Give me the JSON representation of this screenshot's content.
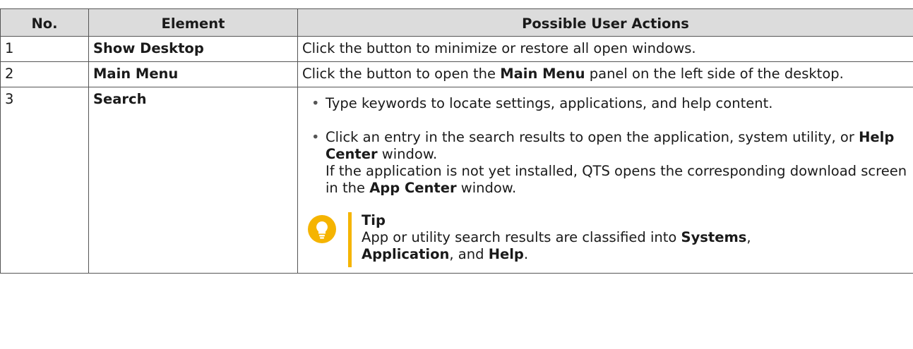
{
  "table": {
    "headers": {
      "no": "No.",
      "element": "Element",
      "actions": "Possible User Actions"
    },
    "rows": [
      {
        "no": "1",
        "element": "Show Desktop",
        "action": "Click the button to minimize or restore all open windows."
      },
      {
        "no": "2",
        "element": "Main Menu",
        "action_pre": "Click the button to open the ",
        "action_bold": "Main Menu",
        "action_post": " panel on the left side of the desktop."
      },
      {
        "no": "3",
        "element": "Search",
        "bullet1": "Type keywords to locate settings, applications, and help content.",
        "bullet2_pre": "Click an entry in the search results to open the application, system utility, or ",
        "bullet2_bold": "Help Center",
        "bullet2_post": " window.",
        "bullet2_line2_pre": "If the application is not yet installed, QTS opens the corresponding download screen in the ",
        "bullet2_line2_bold": "App Center",
        "bullet2_line2_post": " window.",
        "tip": {
          "icon": "lightbulb-icon",
          "title": "Tip",
          "text_pre": "App or utility search results are classified into ",
          "bold1": "Systems",
          "mid1": ", ",
          "bold2": "Application",
          "mid2": ", and ",
          "bold3": "Help",
          "post": "."
        }
      }
    ]
  },
  "colors": {
    "header_bg": "#dcdcdc",
    "tip_accent": "#f5b400",
    "border": "#555555"
  }
}
